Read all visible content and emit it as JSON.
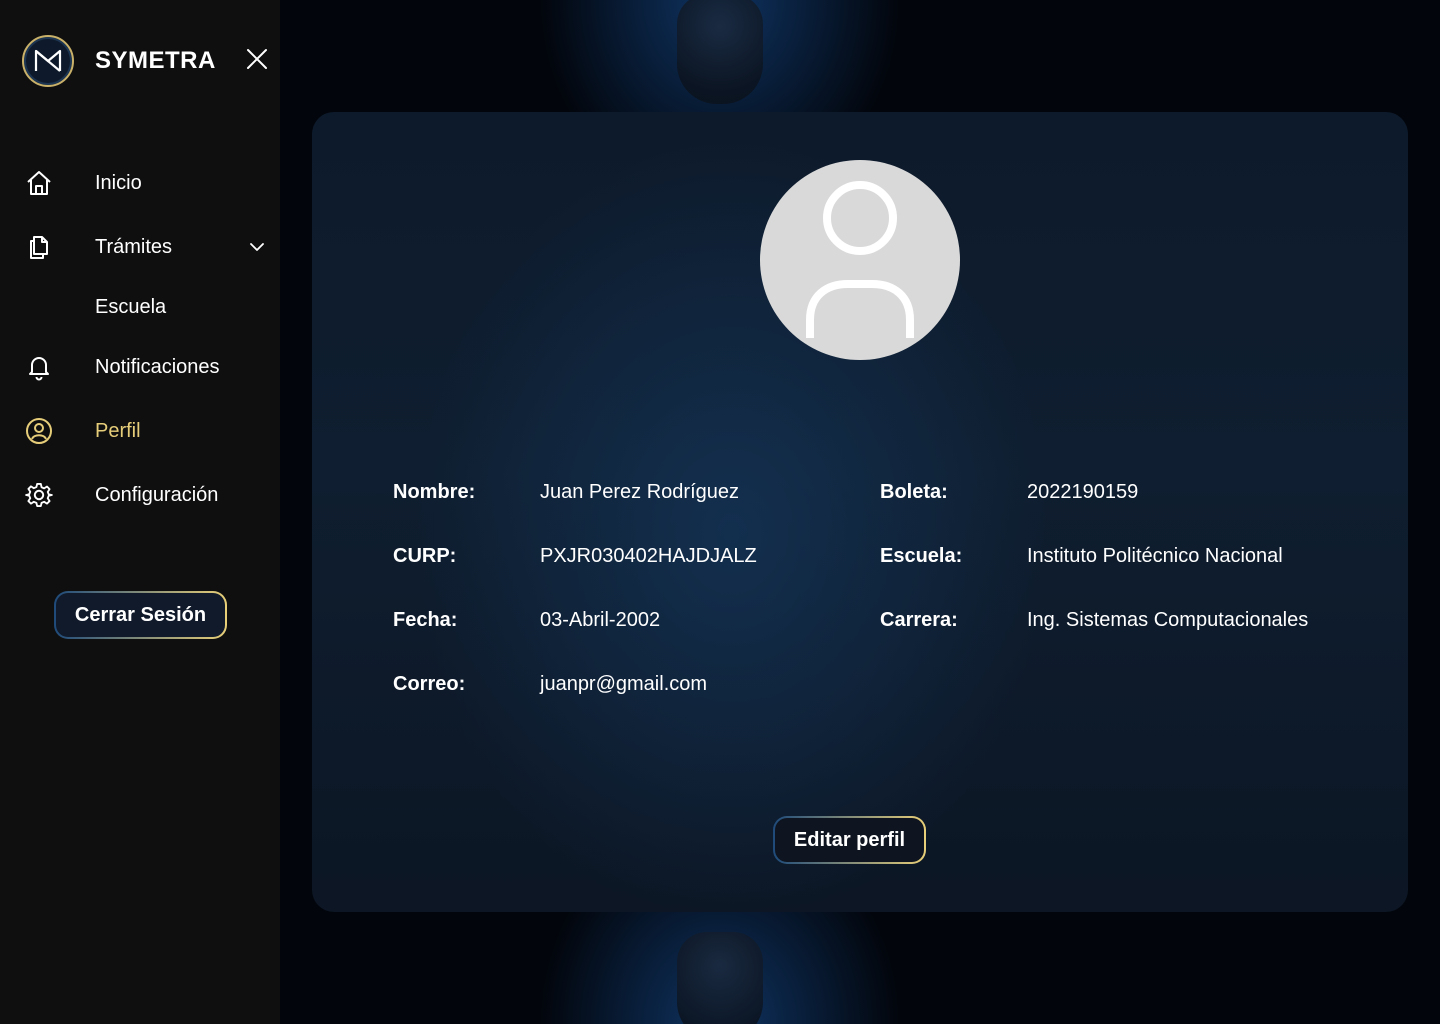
{
  "brand": {
    "name": "SYMETRA",
    "logo_icon": "symetra-logo-icon"
  },
  "colors": {
    "accent": "#e6cd7a",
    "sidebar_bg": "#0f0f0f",
    "card_bg": "#0f1e30"
  },
  "sidebar": {
    "items": [
      {
        "label": "Inicio",
        "icon": "home-icon"
      },
      {
        "label": "Trámites",
        "icon": "documents-icon"
      },
      {
        "label": "Escuela"
      },
      {
        "label": "Notificaciones",
        "icon": "bell-icon"
      },
      {
        "label": "Perfil",
        "icon": "user-circle-icon",
        "active": true
      },
      {
        "label": "Configuración",
        "icon": "gear-icon"
      }
    ],
    "logout_label": "Cerrar Sesión"
  },
  "profile": {
    "fields": {
      "nombre": {
        "label": "Nombre:",
        "value": "Juan Perez Rodríguez"
      },
      "curp": {
        "label": "CURP:",
        "value": "PXJR030402HAJDJALZ"
      },
      "fecha": {
        "label": "Fecha:",
        "value": "03-Abril-2002"
      },
      "correo": {
        "label": "Correo:",
        "value": "juanpr@gmail.com"
      },
      "boleta": {
        "label": "Boleta:",
        "value": "2022190159"
      },
      "escuela": {
        "label": "Escuela:",
        "value": "Instituto Politécnico Nacional"
      },
      "carrera": {
        "label": "Carrera:",
        "value": "Ing. Sistemas Computacionales"
      }
    },
    "edit_label": "Editar perfil"
  }
}
